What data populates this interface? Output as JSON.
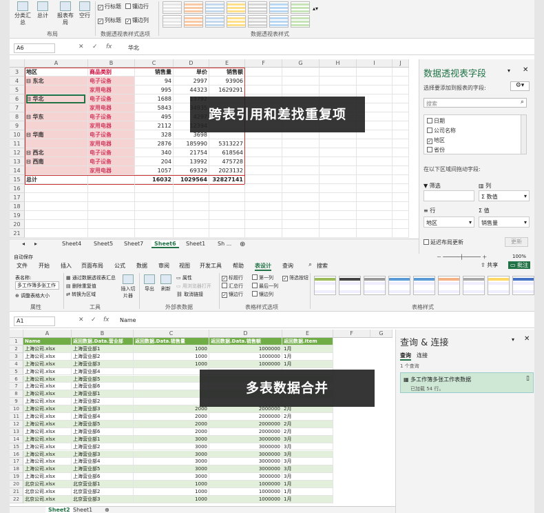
{
  "top": {
    "ribbon": {
      "layout_buttons": [
        "分类汇总",
        "总计",
        "报表布局",
        "空行"
      ],
      "layout_group": "布局",
      "checkboxes": [
        {
          "label": "行标题",
          "checked": true
        },
        {
          "label": "镶边行",
          "checked": false
        },
        {
          "label": "列标题",
          "checked": true
        },
        {
          "label": "镶边列",
          "checked": true
        }
      ],
      "options_group": "数据透视表样式选项",
      "styles_group": "数据透视表样式"
    },
    "formula": {
      "name_box": "A6",
      "value": "华北"
    },
    "col_headers": [
      "A",
      "B",
      "C",
      "D",
      "E",
      "F",
      "G",
      "H",
      "I",
      "J"
    ],
    "row_headers": [
      "3",
      "4",
      "5",
      "6",
      "7",
      "8",
      "9",
      "10",
      "11",
      "12",
      "13",
      "14",
      "15",
      "16",
      "17",
      "18",
      "19",
      "20",
      "21"
    ],
    "pivot_header": [
      "地区",
      "商品类别",
      "销售量",
      "单价",
      "销售额"
    ],
    "pivot_rows": [
      [
        "⊟ 东北",
        "电子设备",
        "94",
        "2997",
        "93906"
      ],
      [
        "",
        "家用电器",
        "995",
        "44323",
        "1629291"
      ],
      [
        "⊟ 华北",
        "电子设备",
        "1688",
        "13792",
        ""
      ],
      [
        "",
        "家用电器",
        "5843",
        "34935",
        ""
      ],
      [
        "⊟ 华东",
        "电子设备",
        "495",
        "4297",
        ""
      ],
      [
        "",
        "家用电器",
        "2112",
        "12394",
        ""
      ],
      [
        "⊟ 华南",
        "电子设备",
        "328",
        "3698",
        ""
      ],
      [
        "",
        "家用电器",
        "2876",
        "185990",
        "5313227"
      ],
      [
        "⊟ 西北",
        "电子设备",
        "340",
        "21754",
        "618564"
      ],
      [
        "⊟ 西南",
        "电子设备",
        "204",
        "13992",
        "475728"
      ],
      [
        "",
        "家用电器",
        "1057",
        "69329",
        "2023132"
      ]
    ],
    "pivot_total": [
      "总计",
      "",
      "16032",
      "1029564",
      "32827141"
    ],
    "sheet_tabs": [
      "Sheet4",
      "Sheet5",
      "Sheet7",
      "Sheet6",
      "Sheet1",
      "Sh ..."
    ],
    "active_tab": "Sheet6",
    "caption": "跨表引用和差找重复项",
    "pivot_pane": {
      "title": "数据透视表字段",
      "subtitle": "选择要添加到报表的字段:",
      "search_placeholder": "搜索",
      "fields": [
        {
          "label": "日期",
          "checked": false
        },
        {
          "label": "公司名称",
          "checked": false
        },
        {
          "label": "地区",
          "checked": true
        },
        {
          "label": "省份",
          "checked": false
        }
      ],
      "drag_label": "在以下区域间拖动字段:",
      "area_filter": "筛选",
      "area_cols": "列",
      "area_rows": "行",
      "area_values": "值",
      "col_item": "Σ 数值",
      "row_item": "地区",
      "value_item": "销售量",
      "defer_label": "延迟布局更新",
      "update_btn": "更新"
    }
  },
  "bottom": {
    "title_bar": {
      "left": "自动保存",
      "zoom": "100%"
    },
    "menu": [
      "文件",
      "开始",
      "插入",
      "页面布局",
      "公式",
      "数据",
      "审阅",
      "视图",
      "开发工具",
      "帮助",
      "表设计",
      "查询",
      "搜索"
    ],
    "active_menu": "表设计",
    "share": "共享",
    "comment": "批注",
    "ribbon": {
      "props_label": "表名称:",
      "table_name": "多工作簿多张工作",
      "resize": "调整表格大小",
      "props_group": "属性",
      "tools": [
        "通过数据透视表汇总",
        "删除重复值",
        "转换为区域"
      ],
      "slicer": "插入切片器",
      "tools_group": "工具",
      "ext": [
        "导出",
        "刷新"
      ],
      "ext_small": [
        "属性",
        "用浏览器打开",
        "取消链接"
      ],
      "ext_group": "外部表数据",
      "opts": [
        {
          "label": "标题行",
          "checked": true
        },
        {
          "label": "第一列",
          "checked": false
        },
        {
          "label": "筛选按钮",
          "checked": true
        },
        {
          "label": "汇总行",
          "checked": false
        },
        {
          "label": "最后一列",
          "checked": false
        },
        {
          "label": "镶边行",
          "checked": true
        },
        {
          "label": "镶边列",
          "checked": false
        }
      ],
      "opts_group": "表格样式选项",
      "styles_group": "表格样式"
    },
    "formula": {
      "name_box": "A1",
      "value": "Name"
    },
    "col_headers": [
      "A",
      "B",
      "C",
      "D",
      "E",
      "F",
      "G"
    ],
    "table_header": [
      "Name",
      "返回数据.Data.营业部",
      "返回数据.Data.销售量",
      "返回数据.Data.销售额",
      "返回数据.Item"
    ],
    "rows": [
      [
        "上海公司.xlsx",
        "上海营业部1",
        "1000",
        "1000000",
        "1月"
      ],
      [
        "上海公司.xlsx",
        "上海营业部2",
        "1000",
        "1000000",
        "1月"
      ],
      [
        "上海公司.xlsx",
        "上海营业部3",
        "1000",
        "1000000",
        "1月"
      ],
      [
        "上海公司.xlsx",
        "上海营业部4",
        "",
        "",
        ""
      ],
      [
        "上海公司.xlsx",
        "上海营业部5",
        "",
        "",
        ""
      ],
      [
        "上海公司.xlsx",
        "上海营业部6",
        "",
        "",
        ""
      ],
      [
        "上海公司.xlsx",
        "上海营业部1",
        "",
        "",
        ""
      ],
      [
        "上海公司.xlsx",
        "上海营业部2",
        "",
        "",
        ""
      ],
      [
        "上海公司.xlsx",
        "上海营业部3",
        "2000",
        "2000000",
        "2月"
      ],
      [
        "上海公司.xlsx",
        "上海营业部4",
        "2000",
        "2000000",
        "2月"
      ],
      [
        "上海公司.xlsx",
        "上海营业部5",
        "2000",
        "2000000",
        "2月"
      ],
      [
        "上海公司.xlsx",
        "上海营业部6",
        "2000",
        "2000000",
        "2月"
      ],
      [
        "上海公司.xlsx",
        "上海营业部1",
        "3000",
        "3000000",
        "3月"
      ],
      [
        "上海公司.xlsx",
        "上海营业部2",
        "3000",
        "3000000",
        "3月"
      ],
      [
        "上海公司.xlsx",
        "上海营业部3",
        "3000",
        "3000000",
        "3月"
      ],
      [
        "上海公司.xlsx",
        "上海营业部4",
        "3000",
        "3000000",
        "3月"
      ],
      [
        "上海公司.xlsx",
        "上海营业部5",
        "3000",
        "3000000",
        "3月"
      ],
      [
        "上海公司.xlsx",
        "上海营业部6",
        "3000",
        "3000000",
        "3月"
      ],
      [
        "北京公司.xlsx",
        "北京营业部1",
        "1000",
        "1000000",
        "1月"
      ],
      [
        "北京公司.xlsx",
        "北京营业部2",
        "1000",
        "1000000",
        "1月"
      ],
      [
        "北京公司.xlsx",
        "北京营业部3",
        "1000",
        "1000000",
        "1月"
      ]
    ],
    "sheet_tabs": [
      "Sheet2",
      "Sheet1"
    ],
    "active_tab": "Sheet2",
    "caption": "多表数据合并",
    "query_pane": {
      "title": "查询 & 连接",
      "tabs": [
        "查询",
        "连接"
      ],
      "count": "1 个查询",
      "item_name": "多工作簿多张工作表数据",
      "item_status": "已加载 54 行。"
    }
  }
}
